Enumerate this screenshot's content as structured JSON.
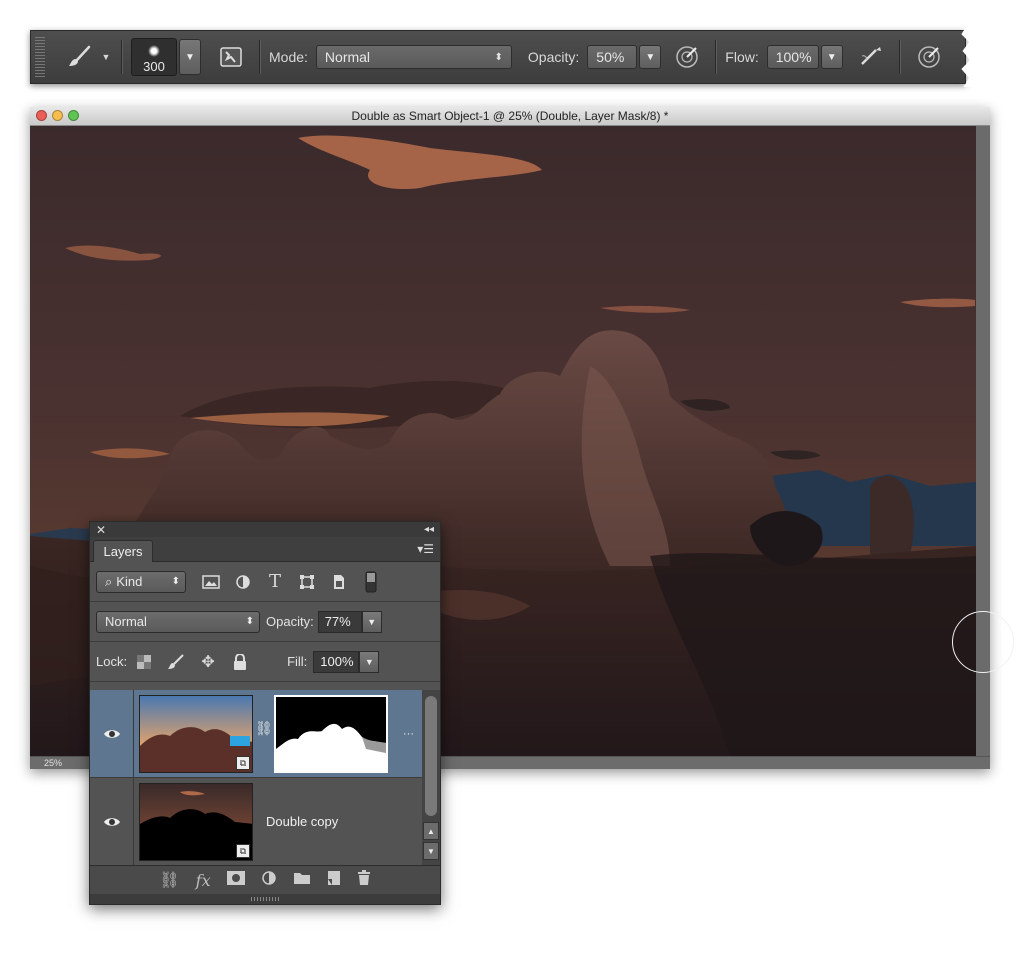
{
  "options_bar": {
    "brush_size": "300",
    "mode_label": "Mode:",
    "mode_value": "Normal",
    "opacity_label": "Opacity:",
    "opacity_value": "50%",
    "flow_label": "Flow:",
    "flow_value": "100%",
    "icons": [
      "brush-tool-icon",
      "brush-preset-icon",
      "brush-panel-icon",
      "pressure-opacity-icon",
      "airbrush-icon",
      "pressure-size-icon"
    ]
  },
  "document": {
    "title": "Double as Smart Object-1 @ 25% (Double, Layer Mask/8) *",
    "zoom": "25%",
    "traffic_lights": {
      "close": "#ec5f57",
      "minimize": "#f6be4f",
      "zoom": "#5fc454"
    }
  },
  "layers_panel": {
    "tab_label": "Layers",
    "filter_kind": "Kind",
    "blend_mode": "Normal",
    "opacity_label": "Opacity:",
    "opacity_value": "77%",
    "lock_label": "Lock:",
    "fill_label": "Fill:",
    "fill_value": "100%",
    "layers": [
      {
        "name": "",
        "visible": true,
        "selected": true,
        "has_mask": true
      },
      {
        "name": "Double copy",
        "visible": true,
        "selected": false,
        "has_mask": false
      }
    ],
    "bottom_icons": [
      "link-layers-icon",
      "fx-icon",
      "add-mask-icon",
      "adjustment-layer-icon",
      "group-folder-icon",
      "new-layer-icon",
      "trash-icon"
    ]
  }
}
